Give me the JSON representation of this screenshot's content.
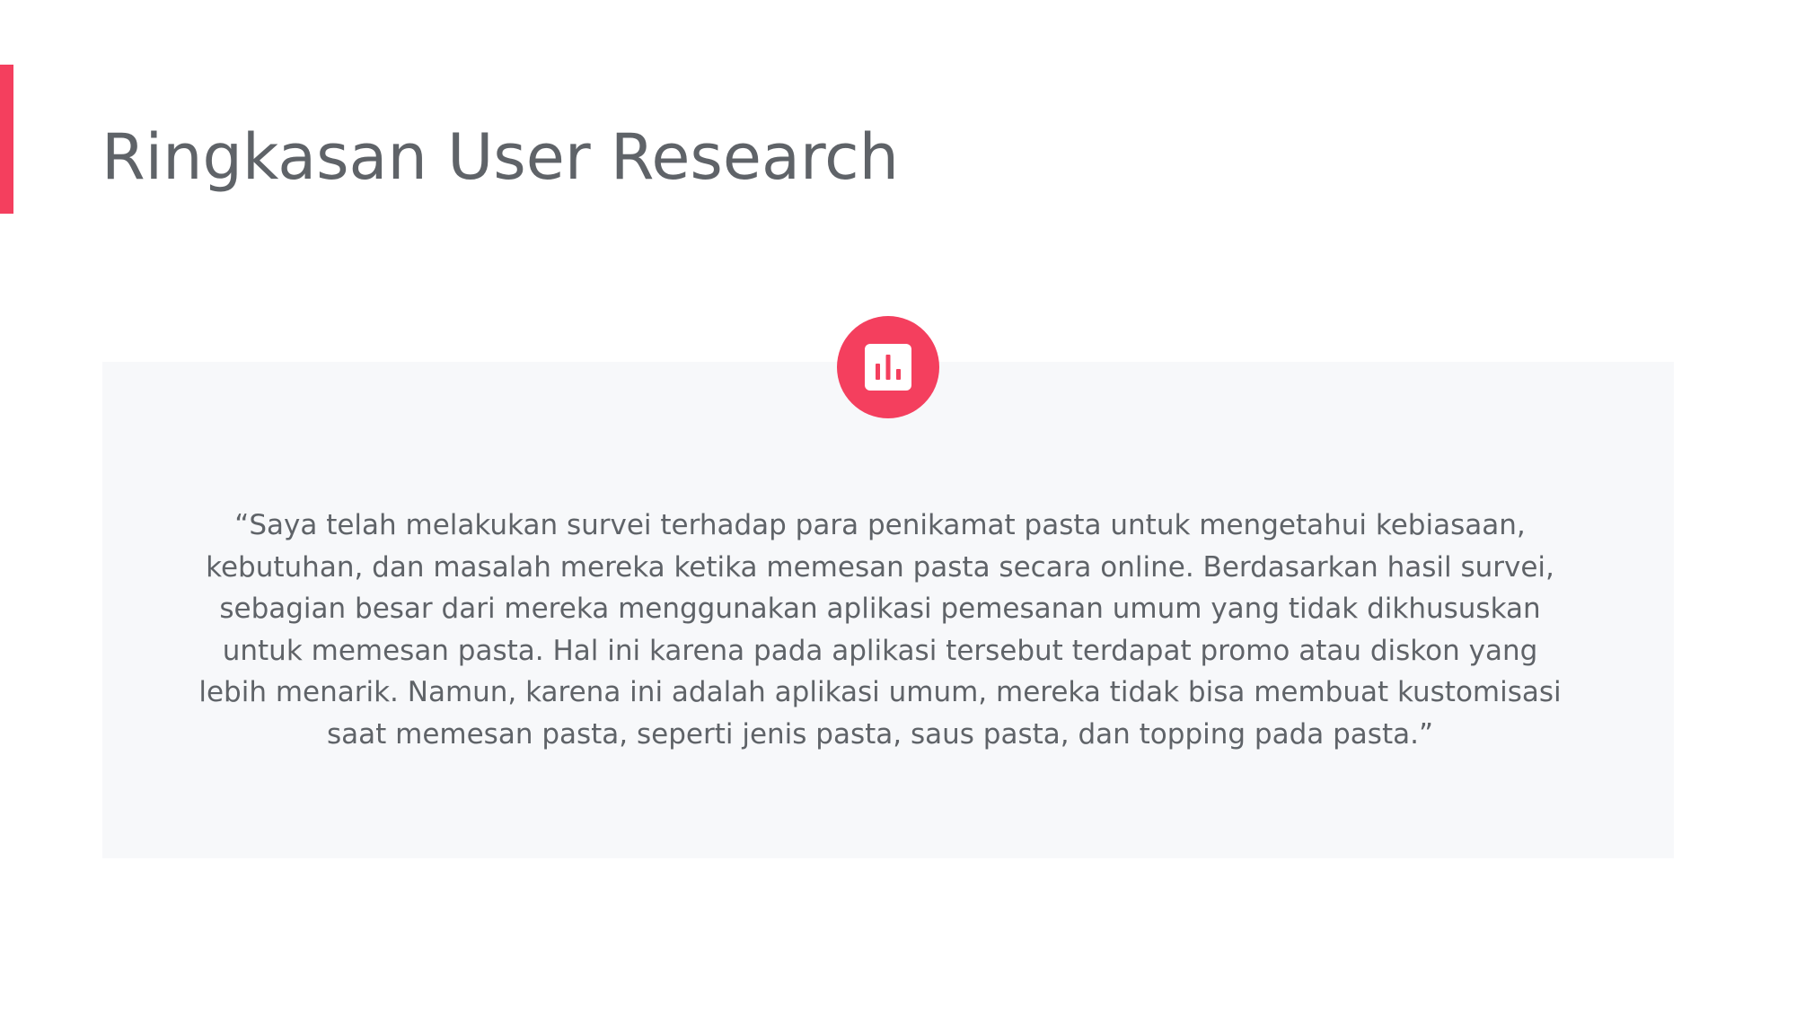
{
  "slide": {
    "title": "Ringkasan User Research",
    "quote": "“Saya telah melakukan survei terhadap para penikamat pasta untuk mengetahui kebiasaan, kebutuhan, dan masalah mereka ketika memesan pasta secara online. Berdasarkan hasil survei, sebagian besar dari mereka menggunakan aplikasi pemesanan umum yang tidak dikhususkan untuk memesan pasta. Hal ini karena pada aplikasi tersebut terdapat promo atau diskon yang lebih menarik. Namun, karena ini adalah aplikasi umum, mereka tidak bisa membuat kustomisasi saat memesan pasta, seperti jenis pasta, saus pasta, dan topping pada pasta.”"
  },
  "icons": {
    "badge": "bar-chart-icon"
  },
  "colors": {
    "accent": "#f43f5e",
    "text": "#5f6368",
    "card_background": "#f7f8fa",
    "page_background": "#ffffff"
  }
}
